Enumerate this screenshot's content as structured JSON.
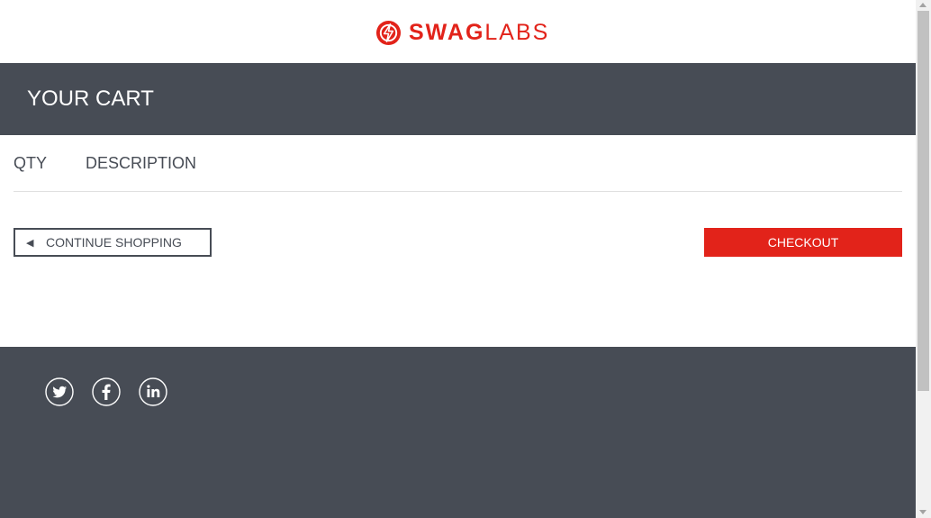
{
  "header": {
    "logo_icon": "swag-labs-logo-icon",
    "logo_bold": "SWAG",
    "logo_light": "LABS",
    "brand_color": "#e2231a"
  },
  "subheader": {
    "title": "YOUR CART",
    "background_color": "#474c55"
  },
  "cart": {
    "qty_label": "QTY",
    "description_label": "DESCRIPTION",
    "continue_icon": "left-triangle-icon",
    "continue_label": "CONTINUE SHOPPING",
    "checkout_label": "CHECKOUT"
  },
  "footer": {
    "social": [
      {
        "name": "twitter",
        "icon": "twitter-icon"
      },
      {
        "name": "facebook",
        "icon": "facebook-icon"
      },
      {
        "name": "linkedin",
        "icon": "linkedin-icon"
      }
    ]
  }
}
